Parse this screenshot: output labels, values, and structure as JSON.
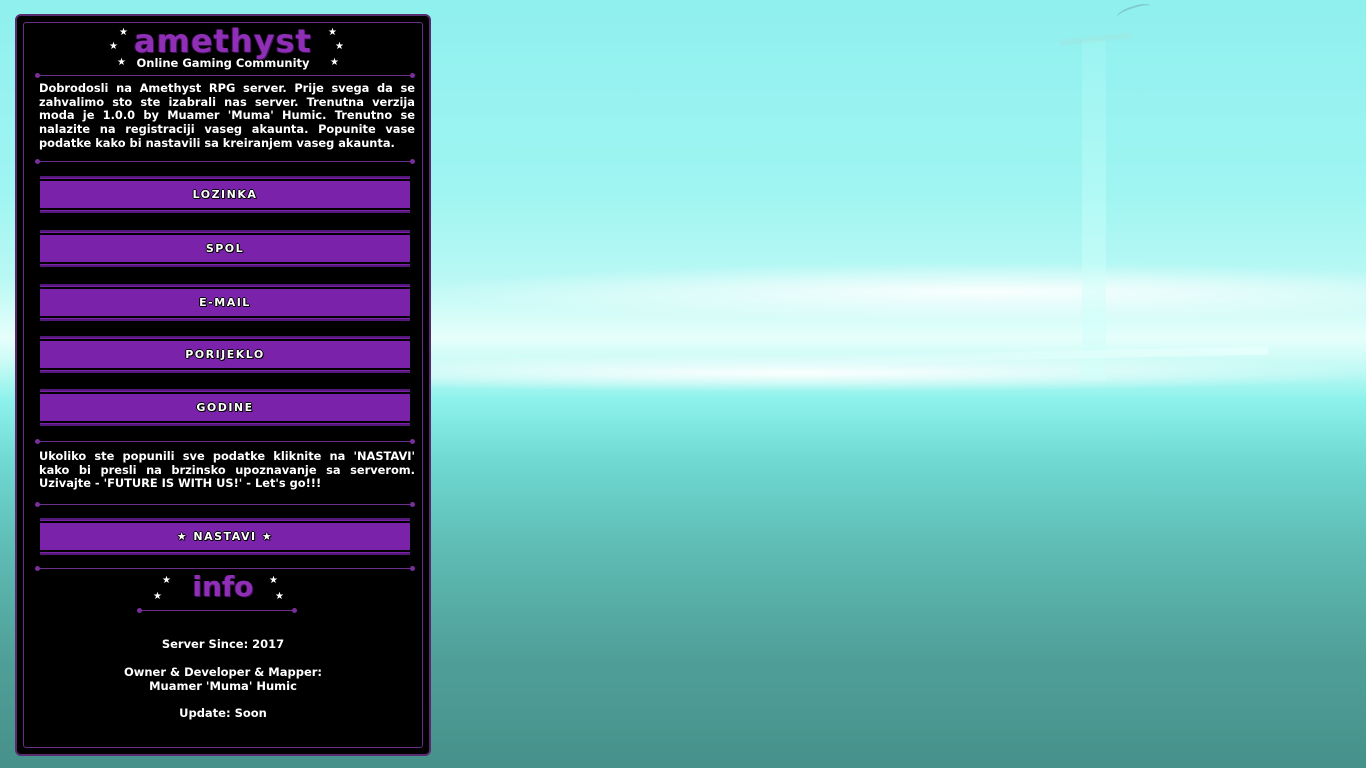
{
  "panel": {
    "logo": "amethyst",
    "subtitle": "Online Gaming Community",
    "welcome_text": "Dobrodosli na Amethyst RPG server. Prije svega da se zahvalimo sto ste izabrali nas server. Trenutna verzija moda je 1.0.0 by Muamer 'Muma' Humic. Trenutno se nalazite na registraciji vaseg akaunta. Popunite vase podatke kako bi nastavili sa kreiranjem vaseg akaunta.",
    "buttons": [
      {
        "label": "LOZINKA"
      },
      {
        "label": "SPOL"
      },
      {
        "label": "E-MAIL"
      },
      {
        "label": "PORIJEKLO"
      },
      {
        "label": "GODINE"
      }
    ],
    "continue_text": "Ukoliko ste popunili sve podatke kliknite na 'NASTAVI' kako bi presli na brzinsko upoznavanje sa serverom. Uzivajte - 'FUTURE IS WITH US!' - Let's go!!!",
    "continue_button": "★ NASTAVI ★",
    "info_title": "info",
    "server_since": "Server Since: 2017",
    "owner_label": "Owner & Developer & Mapper:",
    "owner_name": "Muamer 'Muma' Humic",
    "update": "Update: Soon"
  },
  "colors": {
    "accent": "#7a22aa",
    "logo": "#8e2fb6",
    "panel_bg": "#000000"
  }
}
